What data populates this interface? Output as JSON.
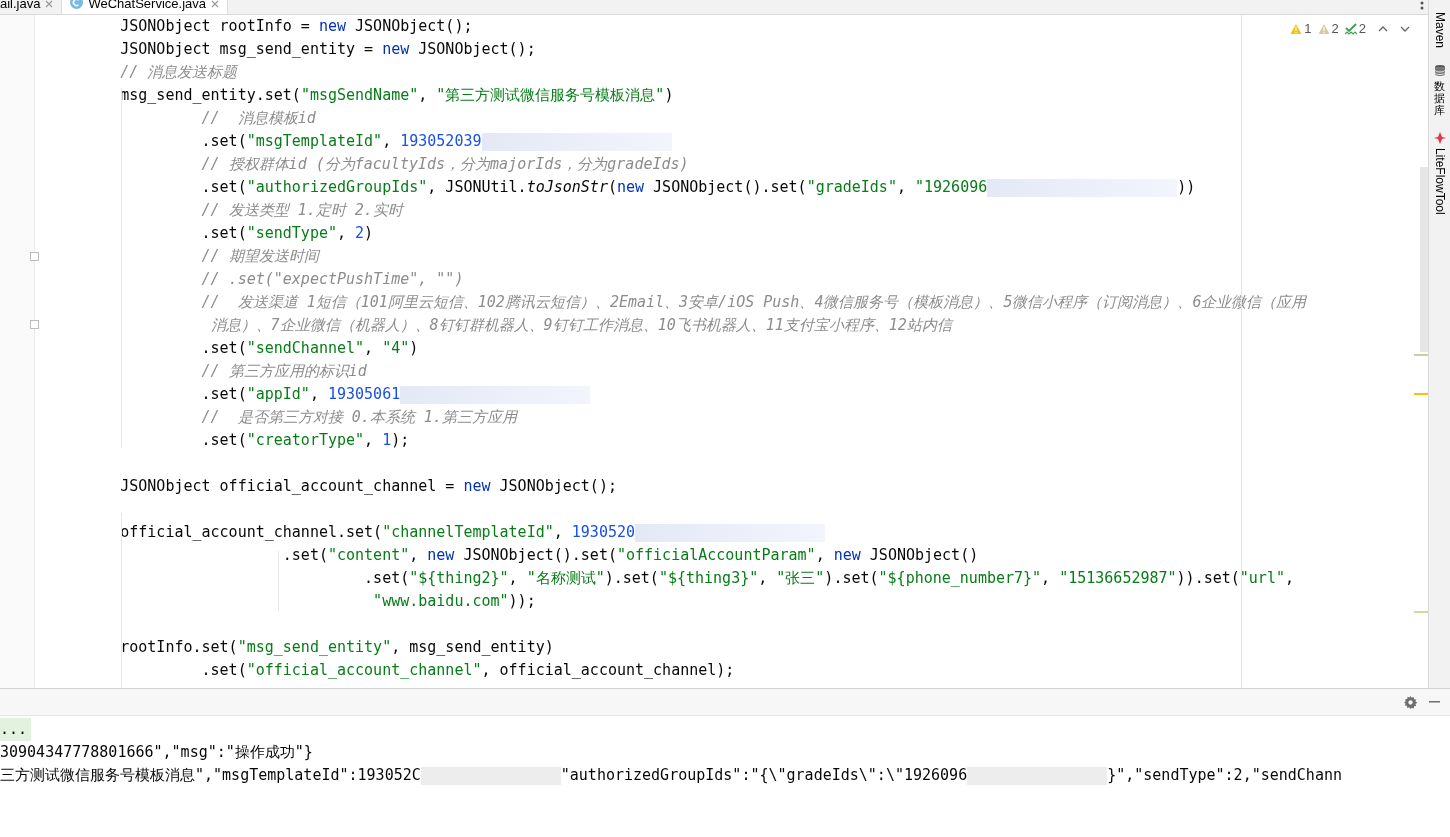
{
  "tabs": [
    {
      "label": "ail.java",
      "kind": "plain",
      "selected": false
    },
    {
      "label": "WeChatService.java",
      "kind": "class",
      "selected": true
    }
  ],
  "inspections": [
    {
      "kind": "warning",
      "count": "1"
    },
    {
      "kind": "weak_warning",
      "count": "2"
    },
    {
      "kind": "typo",
      "count": "2"
    }
  ],
  "code_blocks": [
    {
      "lines": [
        {
          "tokens": [
            {
              "kind": "plain",
              "text": "        JSONObject rootInfo = "
            },
            {
              "kind": "keyword",
              "text": "new"
            },
            {
              "kind": "plain",
              "text": " JSONObject();"
            }
          ]
        },
        {
          "tokens": [
            {
              "kind": "plain",
              "text": "        JSONObject msg_send_entity = "
            },
            {
              "kind": "keyword",
              "text": "new"
            },
            {
              "kind": "plain",
              "text": " JSONObject();"
            }
          ]
        },
        {
          "tokens": [
            {
              "kind": "comment",
              "text": "        // 消息发送标题"
            }
          ]
        },
        {
          "tokens": [
            {
              "kind": "plain",
              "text": "        msg_send_entity.set("
            },
            {
              "kind": "string",
              "text": "\"msgSendName\""
            },
            {
              "kind": "plain",
              "text": ", "
            },
            {
              "kind": "string",
              "text": "\"第三方测试微信服务号模板消息\""
            },
            {
              "kind": "plain",
              "text": ")"
            }
          ]
        },
        {
          "tokens": [
            {
              "kind": "comment",
              "text": "                 //  消息模板id"
            }
          ]
        },
        {
          "tokens": [
            {
              "kind": "plain",
              "text": "                 .set("
            },
            {
              "kind": "string",
              "text": "\"msgTemplateId\""
            },
            {
              "kind": "plain",
              "text": ", "
            },
            {
              "kind": "number",
              "text": "193052039"
            },
            {
              "kind": "blur"
            }
          ]
        },
        {
          "tokens": [
            {
              "kind": "comment",
              "text": "                 // 授权群体id (分为facultyIds，分为majorIds，分为gradeIds)"
            }
          ]
        },
        {
          "tokens": [
            {
              "kind": "plain",
              "text": "                 .set("
            },
            {
              "kind": "string",
              "text": "\"authorizedGroupIds\""
            },
            {
              "kind": "plain",
              "text": ", JSONUtil."
            },
            {
              "kind": "italic",
              "text": "toJsonStr"
            },
            {
              "kind": "plain",
              "text": "("
            },
            {
              "kind": "keyword",
              "text": "new"
            },
            {
              "kind": "plain",
              "text": " JSONObject().set("
            },
            {
              "kind": "string",
              "text": "\"gradeIds\""
            },
            {
              "kind": "plain",
              "text": ", "
            },
            {
              "kind": "string",
              "text": "\"1926096"
            },
            {
              "kind": "blur"
            },
            {
              "kind": "plain",
              "text": "))"
            }
          ]
        },
        {
          "tokens": [
            {
              "kind": "comment",
              "text": "                 // 发送类型 1.定时 2.实时"
            }
          ]
        },
        {
          "tokens": [
            {
              "kind": "plain",
              "text": "                 .set("
            },
            {
              "kind": "string",
              "text": "\"sendType\""
            },
            {
              "kind": "plain",
              "text": ", "
            },
            {
              "kind": "number",
              "text": "2"
            },
            {
              "kind": "plain",
              "text": ")"
            }
          ]
        },
        {
          "tokens": [
            {
              "kind": "comment",
              "text": "                 // 期望发送时间"
            }
          ]
        },
        {
          "tokens": [
            {
              "kind": "comment",
              "text": "                 // .set(\"expectPushTime\", \"\")"
            }
          ]
        },
        {
          "tokens": [
            {
              "kind": "comment",
              "text": "                 //  发送渠道 1短信（101阿里云短信、102腾讯云短信）、2Email、3安卓/iOS Push、4微信服务号（模板消息）、5微信小程序（订阅消息）、6企业微信（应用"
            }
          ]
        },
        {
          "tokens": [
            {
              "kind": "comment",
              "text": "                  消息）、7企业微信（机器人）、8钉钉群机器人、9钉钉工作消息、10飞书机器人、11支付宝小程序、12站内信"
            }
          ]
        },
        {
          "tokens": [
            {
              "kind": "plain",
              "text": "                 .set("
            },
            {
              "kind": "string",
              "text": "\"sendChannel\""
            },
            {
              "kind": "plain",
              "text": ", "
            },
            {
              "kind": "string",
              "text": "\"4\""
            },
            {
              "kind": "plain",
              "text": ")"
            }
          ]
        },
        {
          "tokens": [
            {
              "kind": "comment",
              "text": "                 // 第三方应用的标识id"
            }
          ]
        },
        {
          "tokens": [
            {
              "kind": "plain",
              "text": "                 .set("
            },
            {
              "kind": "string",
              "text": "\"appId\""
            },
            {
              "kind": "plain",
              "text": ", "
            },
            {
              "kind": "number",
              "text": "19305061"
            },
            {
              "kind": "blur"
            }
          ]
        },
        {
          "tokens": [
            {
              "kind": "comment",
              "text": "                 //  是否第三方对接 0.本系统 1.第三方应用"
            }
          ]
        },
        {
          "tokens": [
            {
              "kind": "plain",
              "text": "                 .set("
            },
            {
              "kind": "string",
              "text": "\"creatorType\""
            },
            {
              "kind": "plain",
              "text": ", "
            },
            {
              "kind": "number",
              "text": "1"
            },
            {
              "kind": "plain",
              "text": ");"
            }
          ]
        }
      ]
    },
    {
      "lines": [
        {
          "tokens": [
            {
              "kind": "plain",
              "text": "        JSONObject official_account_channel = "
            },
            {
              "kind": "keyword",
              "text": "new"
            },
            {
              "kind": "plain",
              "text": " JSONObject();"
            }
          ]
        }
      ]
    },
    {
      "lines": [
        {
          "tokens": [
            {
              "kind": "plain",
              "text": "        official_account_channel.set("
            },
            {
              "kind": "string",
              "text": "\"channelTemplateId\""
            },
            {
              "kind": "plain",
              "text": ", "
            },
            {
              "kind": "number",
              "text": "1930520"
            },
            {
              "kind": "blur"
            }
          ]
        },
        {
          "tokens": [
            {
              "kind": "plain",
              "text": "                          .set("
            },
            {
              "kind": "string",
              "text": "\"content\""
            },
            {
              "kind": "plain",
              "text": ", "
            },
            {
              "kind": "keyword",
              "text": "new"
            },
            {
              "kind": "plain",
              "text": " JSONObject().set("
            },
            {
              "kind": "string",
              "text": "\"officialAccountParam\""
            },
            {
              "kind": "plain",
              "text": ", "
            },
            {
              "kind": "keyword",
              "text": "new"
            },
            {
              "kind": "plain",
              "text": " JSONObject()"
            }
          ]
        },
        {
          "tokens": [
            {
              "kind": "plain",
              "text": "                                   .set("
            },
            {
              "kind": "string",
              "text": "\"${thing2}\""
            },
            {
              "kind": "plain",
              "text": ", "
            },
            {
              "kind": "string",
              "text": "\"名称测试\""
            },
            {
              "kind": "plain",
              "text": ").set("
            },
            {
              "kind": "string",
              "text": "\"${thing3}\""
            },
            {
              "kind": "plain",
              "text": ", "
            },
            {
              "kind": "string",
              "text": "\"张三\""
            },
            {
              "kind": "plain",
              "text": ").set("
            },
            {
              "kind": "string",
              "text": "\"${phone_number7}\""
            },
            {
              "kind": "plain",
              "text": ", "
            },
            {
              "kind": "string",
              "text": "\"15136652987\""
            },
            {
              "kind": "plain",
              "text": ")).set("
            },
            {
              "kind": "string",
              "text": "\"url\""
            },
            {
              "kind": "plain",
              "text": ","
            }
          ]
        },
        {
          "tokens": [
            {
              "kind": "string",
              "text": "                                    \"www.baidu.com\""
            },
            {
              "kind": "plain",
              "text": "));"
            }
          ]
        }
      ]
    },
    {
      "lines": [
        {
          "tokens": [
            {
              "kind": "plain",
              "text": "        rootInfo.set("
            },
            {
              "kind": "string",
              "text": "\"msg_send_entity\""
            },
            {
              "kind": "plain",
              "text": ", msg_send_entity)"
            }
          ]
        },
        {
          "tokens": [
            {
              "kind": "plain",
              "text": "                 .set("
            },
            {
              "kind": "string",
              "text": "\"official_account_channel\""
            },
            {
              "kind": "plain",
              "text": ", official_account_channel);"
            }
          ]
        }
      ]
    }
  ],
  "tool_windows": [
    {
      "kind": "maven",
      "label": "Maven"
    },
    {
      "kind": "database",
      "label": "数据库"
    },
    {
      "kind": "liteflow",
      "label": "LiteFlowTool"
    }
  ],
  "console_lines": [
    {
      "kind": "folded",
      "tokens": [
        {
          "kind": "plain",
          "text": "..."
        }
      ]
    },
    {
      "kind": "output",
      "tokens": [
        {
          "kind": "plain",
          "text": "30904347778801666\",\"msg\":\"操作成功\"}"
        }
      ]
    },
    {
      "kind": "output",
      "tokens": [
        {
          "kind": "plain",
          "text": "三方测试微信服务号模板消息\",\"msgTemplateId\":193052C"
        },
        {
          "kind": "blur"
        },
        {
          "kind": "plain",
          "text": "\"authorizedGroupIds\":\"{\\\"gradeIds\\\":\\\"1926096"
        },
        {
          "kind": "blur"
        },
        {
          "kind": "plain",
          "text": "}\",\"sendType\":2,\"sendChann"
        }
      ]
    }
  ]
}
